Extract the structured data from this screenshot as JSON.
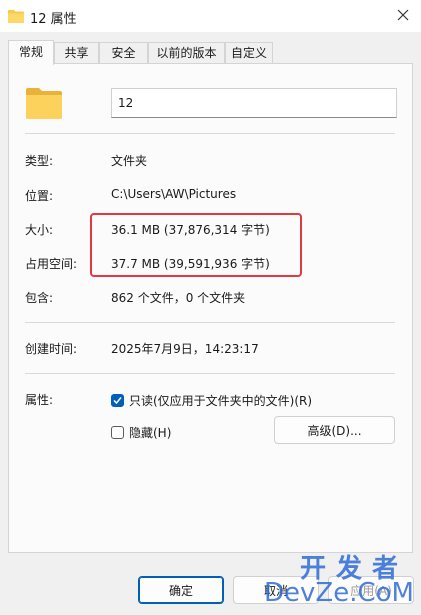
{
  "window": {
    "title": "12 属性"
  },
  "tabs": [
    {
      "label": "常规",
      "active": true
    },
    {
      "label": "共享",
      "active": false
    },
    {
      "label": "安全",
      "active": false
    },
    {
      "label": "以前的版本",
      "active": false
    },
    {
      "label": "自定义",
      "active": false
    }
  ],
  "general": {
    "name_value": "12",
    "type_label": "类型:",
    "type_value": "文件夹",
    "location_label": "位置:",
    "location_value": "C:\\Users\\AW\\Pictures",
    "size_label": "大小:",
    "size_value": "36.1 MB (37,876,314 字节)",
    "size_on_disk_label": "占用空间:",
    "size_on_disk_value": "37.7 MB (39,591,936 字节)",
    "contains_label": "包含:",
    "contains_value": "862 个文件，0 个文件夹",
    "created_label": "创建时间:",
    "created_value": "2025年7月9日，14:23:17",
    "attributes_label": "属性:",
    "readonly_label": "只读(仅应用于文件夹中的文件)(R)",
    "readonly_checked": true,
    "hidden_label": "隐藏(H)",
    "hidden_checked": false,
    "advanced_button": "高级(D)..."
  },
  "footer": {
    "ok_button": "确定",
    "cancel_button": "取消",
    "apply_button": "应用(A)"
  },
  "watermark": {
    "line1": "开发者",
    "line2": "DevZe.CoM"
  },
  "colors": {
    "accent": "#005fb8",
    "highlight_box": "#e0393e",
    "folder_yellow": "#f8c94a",
    "watermark": "#2f6cd6"
  },
  "icons": {
    "title": "folder-icon",
    "close": "close-icon",
    "main": "folder-icon",
    "check": "checkmark-icon"
  }
}
